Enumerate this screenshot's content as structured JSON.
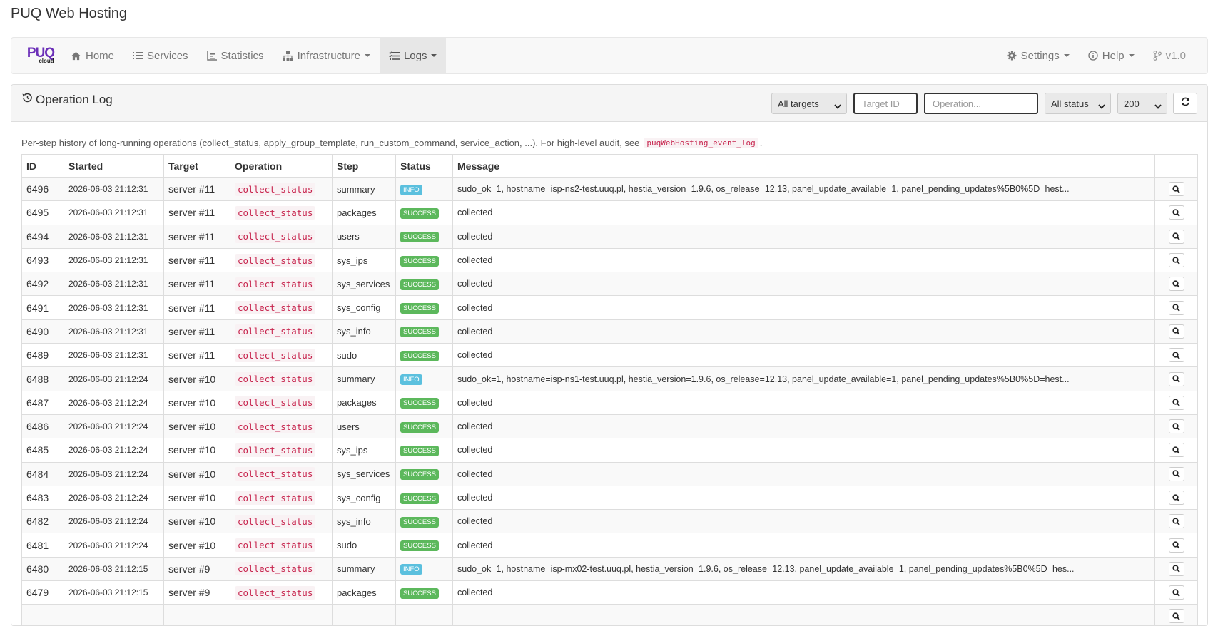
{
  "app_title": "PUQ Web Hosting",
  "brand": {
    "main": "PUQ",
    "sub": "cloud"
  },
  "nav": {
    "home": "Home",
    "services": "Services",
    "statistics": "Statistics",
    "infrastructure": "Infrastructure",
    "logs": "Logs",
    "settings": "Settings",
    "help": "Help",
    "version": "v1.0"
  },
  "panel": {
    "title": "Operation Log",
    "filters": {
      "targets": "All targets",
      "target_id_placeholder": "Target ID",
      "operation_placeholder": "Operation...",
      "status": "All status",
      "limit": "200"
    },
    "intro_text": "Per-step history of long-running operations (collect_status, apply_group_template, run_custom_command, service_action, ...). For high-level audit, see",
    "intro_code": "puqWebHosting_event_log",
    "intro_end": "."
  },
  "table": {
    "headers": [
      "ID",
      "Started",
      "Target",
      "Operation",
      "Step",
      "Status",
      "Message",
      ""
    ],
    "rows": [
      {
        "id": "6496",
        "started": "2026-06-03 21:12:31",
        "target": "server #11",
        "operation": "collect_status",
        "step": "summary",
        "status": "INFO",
        "message": "sudo_ok=1, hostname=isp-ns2-test.uuq.pl, hestia_version=1.9.6, os_release=12.13, panel_update_available=1, panel_pending_updates%5B0%5D=hest..."
      },
      {
        "id": "6495",
        "started": "2026-06-03 21:12:31",
        "target": "server #11",
        "operation": "collect_status",
        "step": "packages",
        "status": "SUCCESS",
        "message": "collected"
      },
      {
        "id": "6494",
        "started": "2026-06-03 21:12:31",
        "target": "server #11",
        "operation": "collect_status",
        "step": "users",
        "status": "SUCCESS",
        "message": "collected"
      },
      {
        "id": "6493",
        "started": "2026-06-03 21:12:31",
        "target": "server #11",
        "operation": "collect_status",
        "step": "sys_ips",
        "status": "SUCCESS",
        "message": "collected"
      },
      {
        "id": "6492",
        "started": "2026-06-03 21:12:31",
        "target": "server #11",
        "operation": "collect_status",
        "step": "sys_services",
        "status": "SUCCESS",
        "message": "collected"
      },
      {
        "id": "6491",
        "started": "2026-06-03 21:12:31",
        "target": "server #11",
        "operation": "collect_status",
        "step": "sys_config",
        "status": "SUCCESS",
        "message": "collected"
      },
      {
        "id": "6490",
        "started": "2026-06-03 21:12:31",
        "target": "server #11",
        "operation": "collect_status",
        "step": "sys_info",
        "status": "SUCCESS",
        "message": "collected"
      },
      {
        "id": "6489",
        "started": "2026-06-03 21:12:31",
        "target": "server #11",
        "operation": "collect_status",
        "step": "sudo",
        "status": "SUCCESS",
        "message": "collected"
      },
      {
        "id": "6488",
        "started": "2026-06-03 21:12:24",
        "target": "server #10",
        "operation": "collect_status",
        "step": "summary",
        "status": "INFO",
        "message": "sudo_ok=1, hostname=isp-ns1-test.uuq.pl, hestia_version=1.9.6, os_release=12.13, panel_update_available=1, panel_pending_updates%5B0%5D=hest..."
      },
      {
        "id": "6487",
        "started": "2026-06-03 21:12:24",
        "target": "server #10",
        "operation": "collect_status",
        "step": "packages",
        "status": "SUCCESS",
        "message": "collected"
      },
      {
        "id": "6486",
        "started": "2026-06-03 21:12:24",
        "target": "server #10",
        "operation": "collect_status",
        "step": "users",
        "status": "SUCCESS",
        "message": "collected"
      },
      {
        "id": "6485",
        "started": "2026-06-03 21:12:24",
        "target": "server #10",
        "operation": "collect_status",
        "step": "sys_ips",
        "status": "SUCCESS",
        "message": "collected"
      },
      {
        "id": "6484",
        "started": "2026-06-03 21:12:24",
        "target": "server #10",
        "operation": "collect_status",
        "step": "sys_services",
        "status": "SUCCESS",
        "message": "collected"
      },
      {
        "id": "6483",
        "started": "2026-06-03 21:12:24",
        "target": "server #10",
        "operation": "collect_status",
        "step": "sys_config",
        "status": "SUCCESS",
        "message": "collected"
      },
      {
        "id": "6482",
        "started": "2026-06-03 21:12:24",
        "target": "server #10",
        "operation": "collect_status",
        "step": "sys_info",
        "status": "SUCCESS",
        "message": "collected"
      },
      {
        "id": "6481",
        "started": "2026-06-03 21:12:24",
        "target": "server #10",
        "operation": "collect_status",
        "step": "sudo",
        "status": "SUCCESS",
        "message": "collected"
      },
      {
        "id": "6480",
        "started": "2026-06-03 21:12:15",
        "target": "server #9",
        "operation": "collect_status",
        "step": "summary",
        "status": "INFO",
        "message": "sudo_ok=1, hostname=isp-mx02-test.uuq.pl, hestia_version=1.9.6, os_release=12.13, panel_update_available=1, panel_pending_updates%5B0%5D=hes..."
      },
      {
        "id": "6479",
        "started": "2026-06-03 21:12:15",
        "target": "server #9",
        "operation": "collect_status",
        "step": "packages",
        "status": "SUCCESS",
        "message": "collected"
      },
      {
        "id": "",
        "started": "",
        "target": "",
        "operation": "",
        "step": "",
        "status": "",
        "message": ""
      }
    ]
  },
  "colors": {
    "brand": "#6b2fb8",
    "info": "#5bc0de",
    "success": "#5cb85c",
    "code": "#c7254e"
  }
}
